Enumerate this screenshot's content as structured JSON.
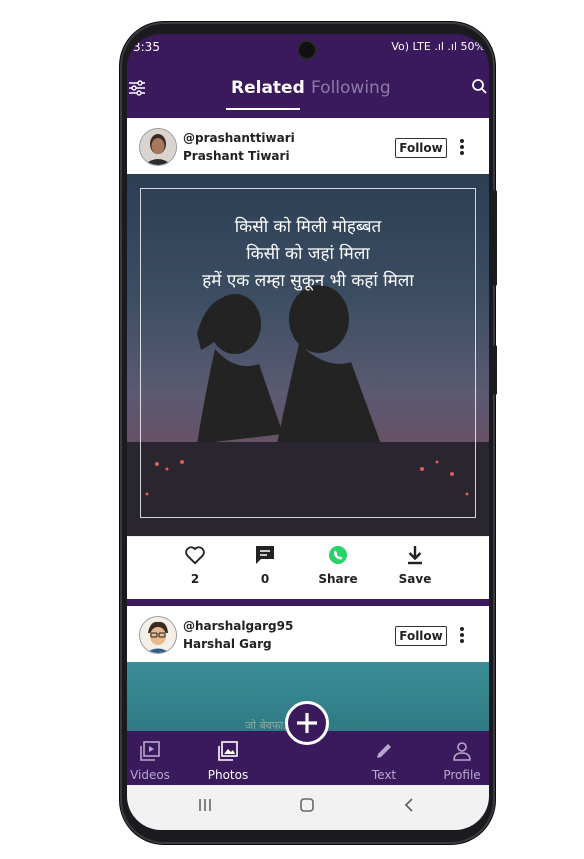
{
  "status": {
    "time": "3:35",
    "right": "Vo) LTE .ıl .ıl 50%"
  },
  "tabs": [
    {
      "label": "Related"
    },
    {
      "label": "Following"
    }
  ],
  "posts": [
    {
      "username": "@prashanttiwari",
      "name": "Prashant Tiwari",
      "follow_label": "Follow",
      "quote_lines": [
        "किसी को मिली मोहब्बत",
        "किसी को जहां मिला",
        "हमें एक लम्हा सुकून भी कहां मिला"
      ],
      "actions": {
        "like_count": "2",
        "comment_count": "0",
        "share_label": "Share",
        "save_label": "Save"
      }
    },
    {
      "username": "@harshalgarg95",
      "name": "Harshal Garg",
      "follow_label": "Follow",
      "faint_text": "जो बेवफा......"
    }
  ],
  "bottom_nav": [
    {
      "label": "Videos"
    },
    {
      "label": "Photos"
    },
    {
      "label": "Text"
    },
    {
      "label": "Profile"
    }
  ],
  "colors": {
    "theme": "#3a1a5c",
    "accent_green": "#25d366"
  }
}
